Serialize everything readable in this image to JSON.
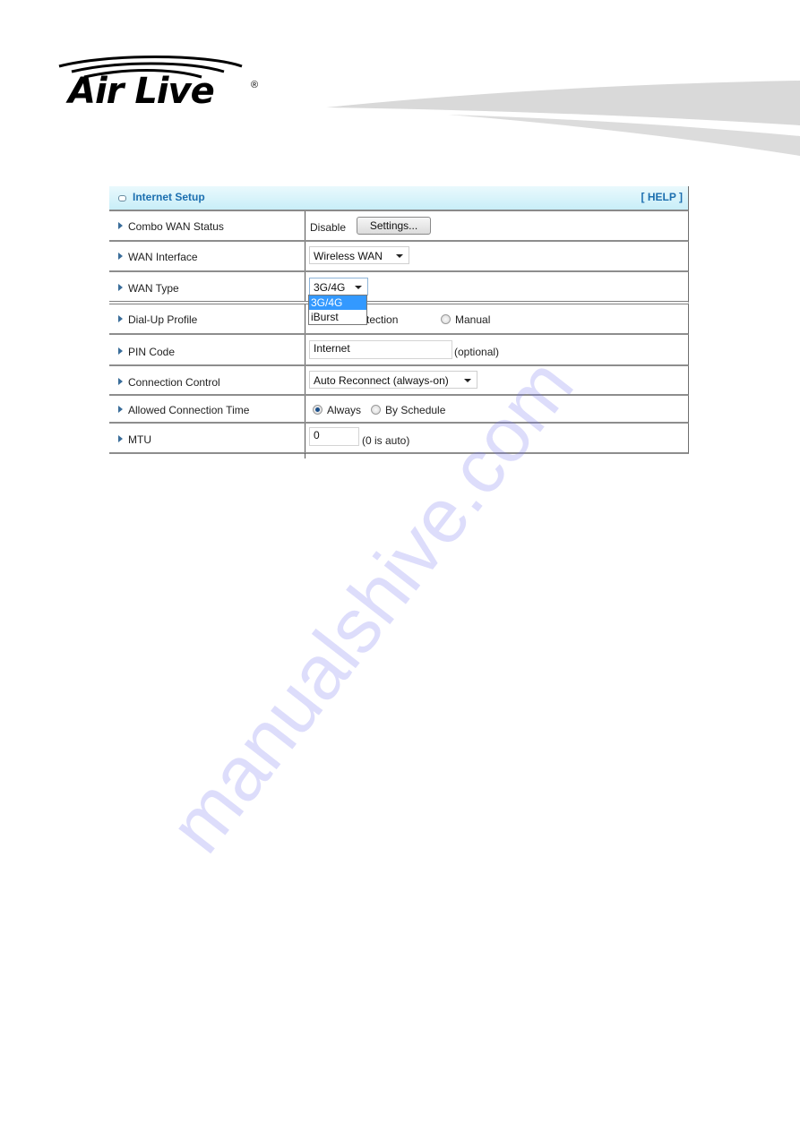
{
  "brand": {
    "name": "Air Live",
    "registered": "®"
  },
  "panel": {
    "title": "Internet Setup",
    "help_label": "[ HELP ]",
    "header_gradient": [
      "#eaf9fd",
      "#c8eef8"
    ],
    "accent_color": "#1d6fb0"
  },
  "rows": {
    "combo_wan_status": {
      "label": "Combo WAN Status",
      "value": "Disable",
      "button": "Settings..."
    },
    "wan_interface": {
      "label": "WAN Interface",
      "selected": "Wireless WAN"
    },
    "wan_type": {
      "label": "WAN Type",
      "selected": "3G/4G",
      "options": [
        "3G/4G",
        "iBurst"
      ],
      "highlighted": "3G/4G"
    },
    "dialup_profile": {
      "label": "Dial-Up Profile",
      "option_auto": "Auto-Detection",
      "option_manual": "Manual",
      "selected": "Auto-Detection"
    },
    "pin_code": {
      "label": "PIN Code",
      "value": "Internet",
      "hint": "(optional)"
    },
    "connection_control": {
      "label": "Connection Control",
      "selected": "Auto Reconnect (always-on)"
    },
    "allowed_connection_time": {
      "label": "Allowed Connection Time",
      "option_always": "Always",
      "option_schedule": "By Schedule",
      "selected": "Always"
    },
    "mtu": {
      "label": "MTU",
      "value": "0",
      "hint": "(0 is auto)"
    }
  },
  "watermark": "manualshive.com"
}
